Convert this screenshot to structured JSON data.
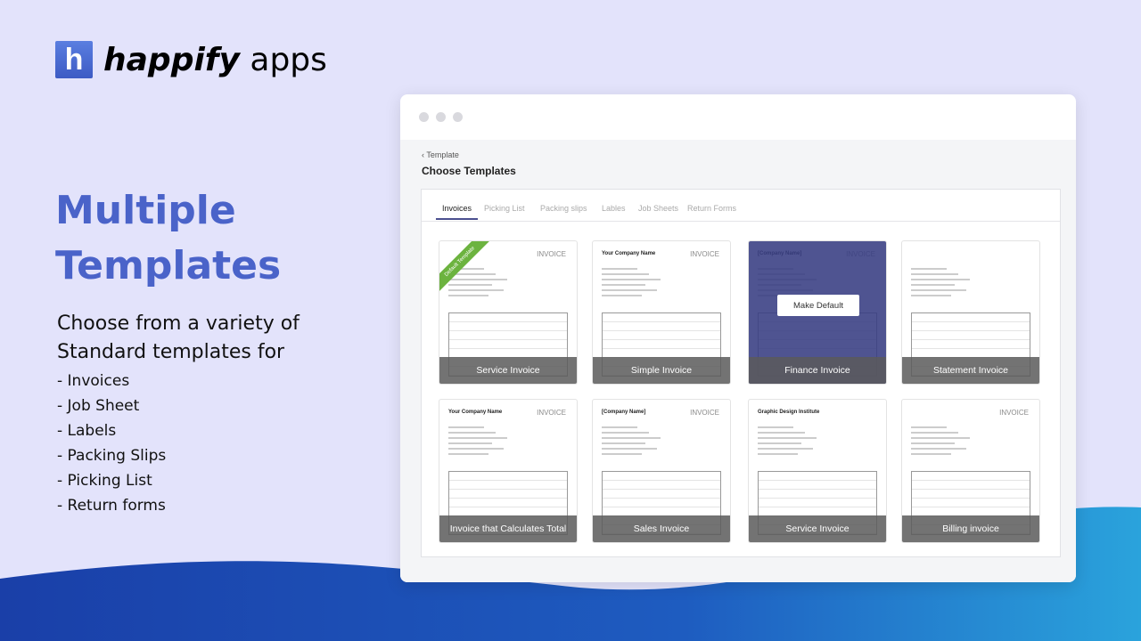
{
  "brand": {
    "mark": "h",
    "name_bold": "happify",
    "name_light": "apps",
    "color": "#4a63c9"
  },
  "hero": {
    "line1": "Multiple",
    "line2": "Templates",
    "sub1": "Choose from a variety of",
    "sub2": "Standard templates for",
    "items": [
      "- Invoices",
      "- Job Sheet",
      "- Labels",
      "- Packing Slips",
      "- Picking List",
      "- Return forms"
    ]
  },
  "app": {
    "back_label": "Template",
    "title": "Choose Templates",
    "tabs": [
      {
        "label": "Invoices",
        "active": true
      },
      {
        "label": "Picking List"
      },
      {
        "label": "Packing slips"
      },
      {
        "label": "Lables"
      },
      {
        "label": "Job Sheets"
      },
      {
        "label": "Return Forms"
      }
    ],
    "default_ribbon": "Default Template",
    "make_default": "Make Default",
    "templates": [
      {
        "name": "Service Invoice",
        "heading": "INVOICE",
        "company": "",
        "default": true
      },
      {
        "name": "Simple Invoice",
        "heading": "INVOICE",
        "company": "Your Company Name"
      },
      {
        "name": "Finance Invoice",
        "heading": "INVOICE",
        "company": "[Company Name]",
        "hovered": true
      },
      {
        "name": "Statement Invoice",
        "heading": "",
        "company": ""
      },
      {
        "name": "Invoice that Calculates Total",
        "heading": "INVOICE",
        "company": "Your Company Name"
      },
      {
        "name": "Sales Invoice",
        "heading": "INVOICE",
        "company": "[Company Name]"
      },
      {
        "name": "Service Invoice",
        "heading": "",
        "company": "Graphic Design Institute"
      },
      {
        "name": "Billing invoice",
        "heading": "INVOICE",
        "company": ""
      }
    ]
  }
}
